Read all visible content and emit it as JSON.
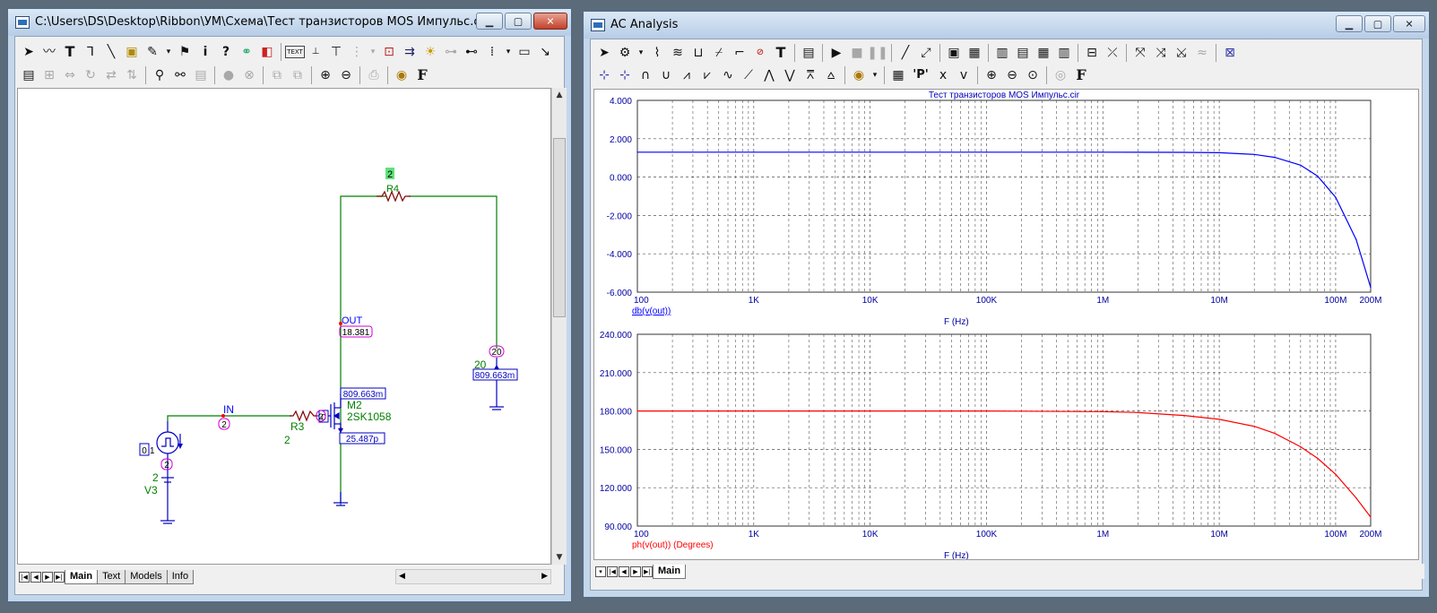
{
  "schematic_window": {
    "title": "C:\\Users\\DS\\Desktop\\Ribbon\\УМ\\Схема\\Тест транзисторов MOS Импульс.cir",
    "tool_text_label": "TEXT",
    "circuit": {
      "node_r4_top": "2",
      "r4_name": "R4",
      "out_label": "OUT",
      "out_voltage": "18.381",
      "node_20": "20",
      "label_20": "20",
      "current_right": "809.663m",
      "current_m2": "809.663m",
      "m2_name": "M2",
      "m2_model": "2SK1058",
      "m2_node": "0",
      "m2_gate_node": "2",
      "gate_current": "25.487p",
      "in_label": "IN",
      "in_node": "2",
      "r3_name": "R3",
      "r3_value": "2",
      "v3_node_left": "0",
      "v3_node_marker": "1",
      "v3_node_bottom": "2",
      "v3_value": "2",
      "v3_name": "V3"
    },
    "tabs": [
      "Main",
      "Text",
      "Models",
      "Info"
    ],
    "active_tab": "Main"
  },
  "ac_window": {
    "title": "AC Analysis",
    "font_button": "F",
    "text_button": "T",
    "p_button": "'P'",
    "tabs": [
      "Main"
    ],
    "active_tab": "Main"
  },
  "chart_data": [
    {
      "type": "line",
      "title": "Тест транзисторов MOS Импульс.cir",
      "xlabel": "F (Hz)",
      "ylabel": "",
      "x_scale": "log",
      "xlim": [
        100,
        200000000
      ],
      "ylim": [
        -6,
        4
      ],
      "x_ticks": [
        "100",
        "1K",
        "10K",
        "100K",
        "1M",
        "10M",
        "100M",
        "200M"
      ],
      "y_ticks": [
        "4.000",
        "2.000",
        "0.000",
        "-2.000",
        "-4.000",
        "-6.000"
      ],
      "grid": true,
      "color": "#0000ff",
      "series": [
        {
          "name": "db(v(out))",
          "x": [
            100,
            1000,
            10000,
            100000,
            1000000,
            5000000,
            10000000,
            20000000,
            30000000,
            50000000,
            70000000,
            100000000,
            150000000,
            200000000
          ],
          "y": [
            1.3,
            1.3,
            1.3,
            1.3,
            1.3,
            1.29,
            1.27,
            1.18,
            1.03,
            0.62,
            0.05,
            -1.05,
            -3.25,
            -5.75
          ]
        }
      ]
    },
    {
      "type": "line",
      "title": "",
      "xlabel": "F (Hz)",
      "ylabel": "",
      "x_scale": "log",
      "xlim": [
        100,
        200000000
      ],
      "ylim": [
        90,
        240
      ],
      "x_ticks": [
        "100",
        "1K",
        "10K",
        "100K",
        "1M",
        "10M",
        "100M",
        "200M"
      ],
      "y_ticks": [
        "240.000",
        "210.000",
        "180.000",
        "150.000",
        "120.000",
        "90.000"
      ],
      "grid": true,
      "color": "#ff0000",
      "series": [
        {
          "name": "ph(v(out)) (Degrees)",
          "x": [
            100,
            1000,
            10000,
            100000,
            1000000,
            2000000,
            5000000,
            10000000,
            20000000,
            30000000,
            50000000,
            70000000,
            100000000,
            150000000,
            200000000
          ],
          "y": [
            180,
            180,
            180,
            180,
            179.5,
            178.8,
            176.5,
            173.5,
            168,
            162.5,
            152,
            143,
            130.5,
            112,
            97
          ]
        }
      ]
    }
  ]
}
